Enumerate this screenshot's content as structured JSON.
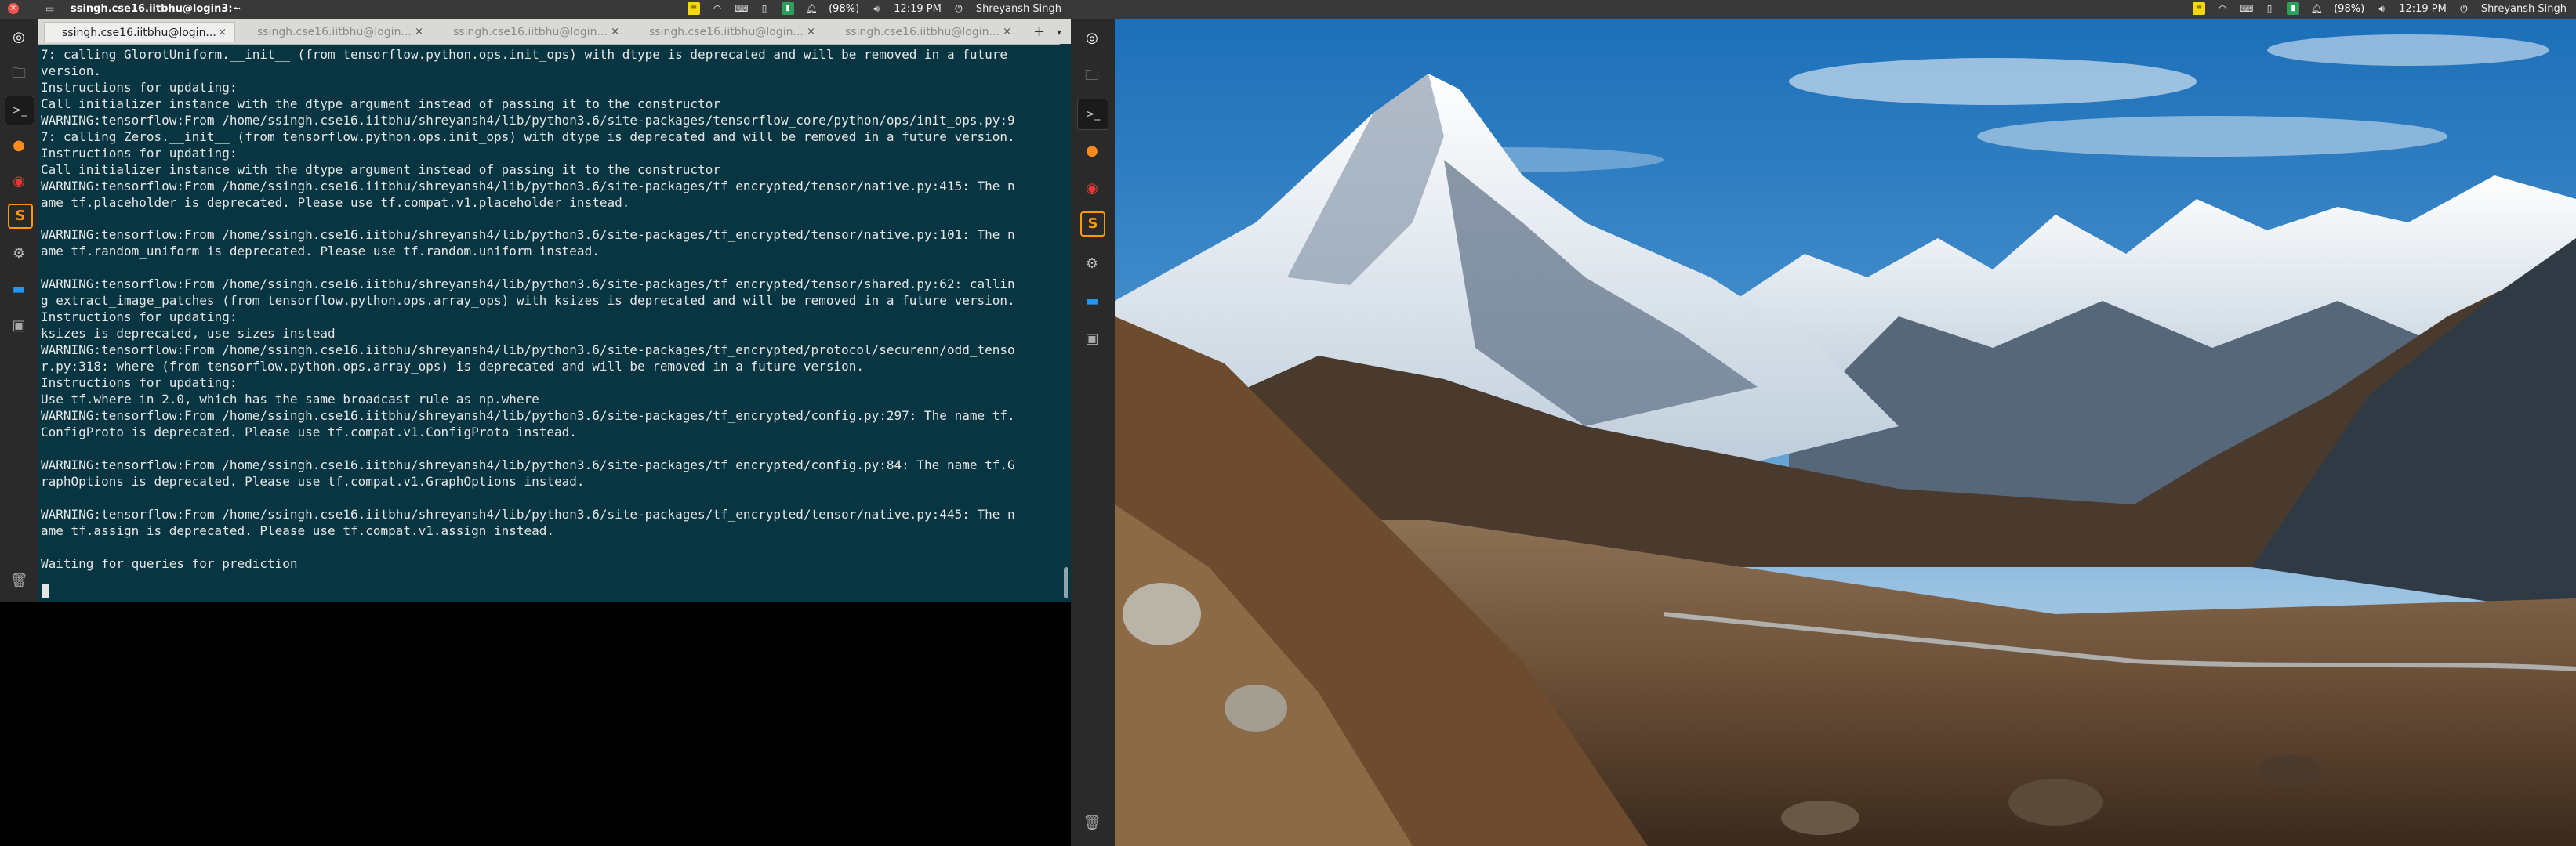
{
  "left_panel": {
    "title": "ssingh.cse16.iitbhu@login3:~",
    "close_symbol": "×",
    "minimize_symbol": "–",
    "battery": "(98%)",
    "time": "12:19 PM",
    "user": "Shreyansh Singh"
  },
  "right_panel": {
    "battery": "(98%)",
    "time": "12:19 PM",
    "user": "Shreyansh Singh"
  },
  "tabs": [
    {
      "label": "ssingh.cse16.iitbhu@login..."
    },
    {
      "label": "ssingh.cse16.iitbhu@login..."
    },
    {
      "label": "ssingh.cse16.iitbhu@login..."
    },
    {
      "label": "ssingh.cse16.iitbhu@login..."
    },
    {
      "label": "ssingh.cse16.iitbhu@login..."
    }
  ],
  "tab_close_symbol": "×",
  "tab_add_symbol": "+",
  "tab_menu_symbol": "▾",
  "terminal_output": "7: calling GlorotUniform.__init__ (from tensorflow.python.ops.init_ops) with dtype is deprecated and will be removed in a future\nversion.\nInstructions for updating:\nCall initializer instance with the dtype argument instead of passing it to the constructor\nWARNING:tensorflow:From /home/ssingh.cse16.iitbhu/shreyansh4/lib/python3.6/site-packages/tensorflow_core/python/ops/init_ops.py:9\n7: calling Zeros.__init__ (from tensorflow.python.ops.init_ops) with dtype is deprecated and will be removed in a future version.\nInstructions for updating:\nCall initializer instance with the dtype argument instead of passing it to the constructor\nWARNING:tensorflow:From /home/ssingh.cse16.iitbhu/shreyansh4/lib/python3.6/site-packages/tf_encrypted/tensor/native.py:415: The n\name tf.placeholder is deprecated. Please use tf.compat.v1.placeholder instead.\n\nWARNING:tensorflow:From /home/ssingh.cse16.iitbhu/shreyansh4/lib/python3.6/site-packages/tf_encrypted/tensor/native.py:101: The n\name tf.random_uniform is deprecated. Please use tf.random.uniform instead.\n\nWARNING:tensorflow:From /home/ssingh.cse16.iitbhu/shreyansh4/lib/python3.6/site-packages/tf_encrypted/tensor/shared.py:62: callin\ng extract_image_patches (from tensorflow.python.ops.array_ops) with ksizes is deprecated and will be removed in a future version.\nInstructions for updating:\nksizes is deprecated, use sizes instead\nWARNING:tensorflow:From /home/ssingh.cse16.iitbhu/shreyansh4/lib/python3.6/site-packages/tf_encrypted/protocol/securenn/odd_tenso\nr.py:318: where (from tensorflow.python.ops.array_ops) is deprecated and will be removed in a future version.\nInstructions for updating:\nUse tf.where in 2.0, which has the same broadcast rule as np.where\nWARNING:tensorflow:From /home/ssingh.cse16.iitbhu/shreyansh4/lib/python3.6/site-packages/tf_encrypted/config.py:297: The name tf.\nConfigProto is deprecated. Please use tf.compat.v1.ConfigProto instead.\n\nWARNING:tensorflow:From /home/ssingh.cse16.iitbhu/shreyansh4/lib/python3.6/site-packages/tf_encrypted/config.py:84: The name tf.G\nraphOptions is deprecated. Please use tf.compat.v1.GraphOptions instead.\n\nWARNING:tensorflow:From /home/ssingh.cse16.iitbhu/shreyansh4/lib/python3.6/site-packages/tf_encrypted/tensor/native.py:445: The n\name tf.assign is deprecated. Please use tf.compat.v1.assign instead.\n\nWaiting for queries for prediction",
  "launcher_icons": [
    "dash-icon",
    "files-icon",
    "terminal-icon",
    "firefox-icon",
    "chrome-icon",
    "sublime-text-icon",
    "settings-icon",
    "remote-desktop-icon",
    "drive-icon",
    "trash-icon"
  ],
  "sublime_glyph": "S",
  "colors": {
    "terminal_bg": "#073642",
    "terminal_fg": "#e6e6e6",
    "panel_bg": "#39393a",
    "launcher_bg": "#2a2a2a"
  },
  "wallpaper": "mountain-landscape"
}
